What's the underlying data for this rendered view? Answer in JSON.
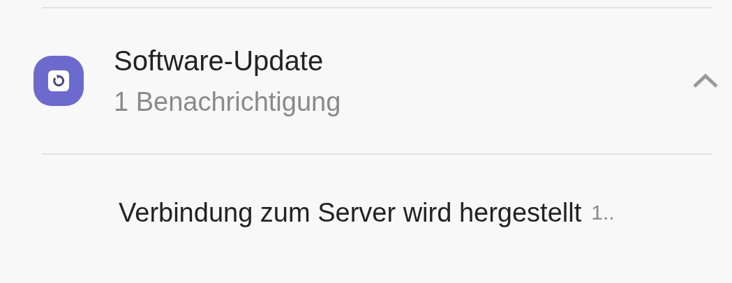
{
  "notification_group": {
    "app_name": "Software-Update",
    "count_text": "1 Benachrichtigung",
    "expanded": true,
    "messages": [
      {
        "text": "Verbindung zum Server wird hergestellt",
        "time": "1.."
      }
    ]
  }
}
